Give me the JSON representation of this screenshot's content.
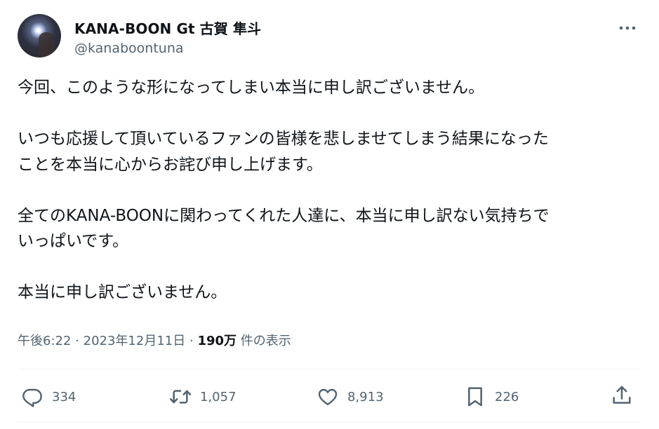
{
  "author": {
    "display_name": "KANA-BOON Gt 古賀 隼斗",
    "handle": "@kanaboontuna"
  },
  "tweet": {
    "text": "今回、このような形になってしまい本当に申し訳ございません。\n\nいつも応援して頂いているファンの皆様を悲しませてしまう結果になった\nことを本当に心からお詫び申し上げます。\n\n全てのKANA-BOONに関わってくれた人達に、本当に申し訳ない気持ちで\nいっぱいです。\n\n本当に申し訳ございません。"
  },
  "meta": {
    "time": "午後6:22",
    "separator": "·",
    "date": "2023年12月11日",
    "views_count": "190万",
    "views_label": "件の表示"
  },
  "actions": {
    "replies": "334",
    "retweets": "1,057",
    "likes": "8,913",
    "bookmarks": "226"
  },
  "icons": {
    "more": "more-horizontal-icon",
    "reply": "reply-icon",
    "retweet": "retweet-icon",
    "like": "heart-icon",
    "bookmark": "bookmark-icon",
    "share": "share-icon"
  },
  "colors": {
    "text": "#0f1419",
    "secondary": "#536471",
    "divider": "#eff3f4"
  }
}
